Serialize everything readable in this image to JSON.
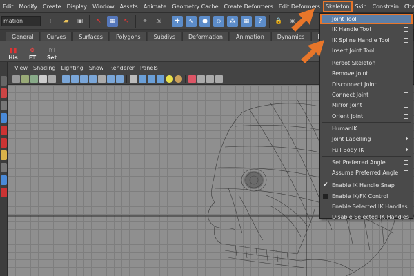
{
  "menubar": {
    "items": [
      "Edit",
      "Modify",
      "Create",
      "Display",
      "Window",
      "Assets",
      "Animate",
      "Geometry Cache",
      "Create Deformers",
      "Edit Deformers",
      "Skeleton",
      "Skin",
      "Constrain",
      "Chara"
    ],
    "active_index": 10
  },
  "statusline": {
    "mode_field": "mation"
  },
  "shelf": {
    "tabs": [
      "General",
      "Curves",
      "Surfaces",
      "Polygons",
      "Subdivs",
      "Deformation",
      "Animation",
      "Dynamics",
      "Renderin"
    ],
    "buttons": [
      "His",
      "FT",
      "Set"
    ]
  },
  "panel": {
    "menu": [
      "View",
      "Shading",
      "Lighting",
      "Show",
      "Renderer",
      "Panels"
    ]
  },
  "skeleton_menu": {
    "items": [
      {
        "label": "Joint Tool",
        "option": true,
        "highlight": true
      },
      {
        "label": "IK Handle Tool",
        "option": true
      },
      {
        "label": "IK Spline Handle Tool",
        "option": true
      },
      {
        "label": "Insert Joint Tool"
      },
      {
        "sep": true
      },
      {
        "label": "Reroot Skeleton"
      },
      {
        "label": "Remove Joint"
      },
      {
        "label": "Disconnect Joint"
      },
      {
        "label": "Connect Joint",
        "option": true
      },
      {
        "label": "Mirror Joint",
        "option": true
      },
      {
        "label": "Orient Joint",
        "option": true
      },
      {
        "sep": true
      },
      {
        "label": "HumanIK..."
      },
      {
        "label": "Joint Labelling",
        "submenu": true
      },
      {
        "label": "Full Body IK",
        "submenu": true
      },
      {
        "sep": true
      },
      {
        "label": "Set Preferred Angle",
        "option": true
      },
      {
        "label": "Assume Preferred Angle",
        "option": true
      },
      {
        "sep": true
      },
      {
        "label": "Enable IK Handle Snap",
        "checked": true
      },
      {
        "label": "Enable IK/FK Control",
        "box": true
      },
      {
        "label": "Enable Selected IK Handles"
      },
      {
        "label": "Disable Selected IK Handles"
      }
    ]
  },
  "colors": {
    "accent_orange": "#e8762a",
    "highlight_blue": "#5c7fa8"
  }
}
